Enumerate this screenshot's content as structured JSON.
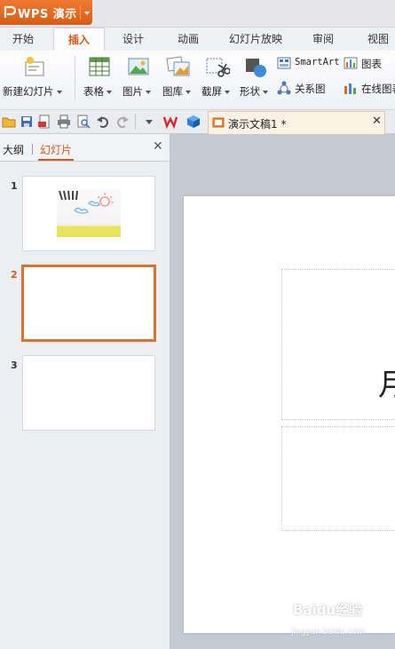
{
  "app": {
    "title": "WPS 演示"
  },
  "menu": {
    "tabs": [
      "开始",
      "插入",
      "设计",
      "动画",
      "幻灯片放映",
      "审阅",
      "视图"
    ],
    "active": "插入"
  },
  "ribbon": {
    "new_slide": "新建幻灯片",
    "table": "表格",
    "picture": "图片",
    "gallery": "图库",
    "screenshot": "截屏",
    "shape": "形状",
    "smartart": "SmartArt",
    "relation": "关系图",
    "chart": "图表",
    "online_chart": "在线图表"
  },
  "document": {
    "tab_title": "演示文稿1 *"
  },
  "left_pane": {
    "outline_tab": "大纲",
    "slides_tab": "幻灯片",
    "thumbnails": [
      {
        "number": "1"
      },
      {
        "number": "2"
      },
      {
        "number": "3"
      }
    ],
    "selected_slide": 2
  },
  "slide": {
    "visible_text": "月"
  },
  "watermark": {
    "logo_text": "Baidu经验",
    "url": "jingyan.baidu.com"
  },
  "colors": {
    "accent": "#d2581b",
    "selected_border": "#d9722e",
    "workspace": "#c5c9d3"
  }
}
